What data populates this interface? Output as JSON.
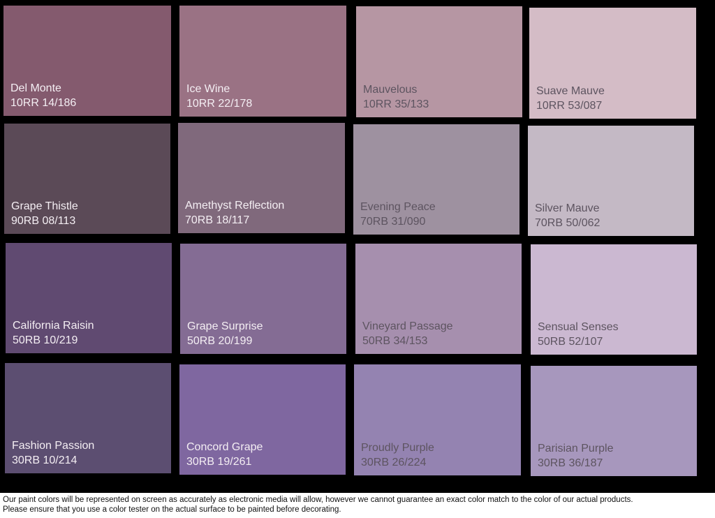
{
  "swatches": [
    {
      "name": "Del Monte",
      "code": "10RR 14/186",
      "color": "#845a6e",
      "text": "light"
    },
    {
      "name": "Ice Wine",
      "code": "10RR 22/178",
      "color": "#9a7284",
      "text": "light"
    },
    {
      "name": "Mauvelous",
      "code": "10RR 35/133",
      "color": "#b696a3",
      "text": "dark"
    },
    {
      "name": "Suave Mauve",
      "code": "10RR 53/087",
      "color": "#d4bcc6",
      "text": "dark"
    },
    {
      "name": "Grape Thistle",
      "code": "90RB 08/113",
      "color": "#5b4a57",
      "text": "light"
    },
    {
      "name": "Amethyst Reflection",
      "code": "70RB 18/117",
      "color": "#80697c",
      "text": "light"
    },
    {
      "name": "Evening Peace",
      "code": "70RB 31/090",
      "color": "#9e91a0",
      "text": "dark"
    },
    {
      "name": "Silver Mauve",
      "code": "70RB 50/062",
      "color": "#c4b9c5",
      "text": "dark"
    },
    {
      "name": "California Raisin",
      "code": "50RB 10/219",
      "color": "#604a71",
      "text": "light"
    },
    {
      "name": "Grape Surprise",
      "code": "50RB 20/199",
      "color": "#846c94",
      "text": "light"
    },
    {
      "name": "Vineyard Passage",
      "code": "50RB 34/153",
      "color": "#a68fae",
      "text": "dark"
    },
    {
      "name": "Sensual Senses",
      "code": "50RB 52/107",
      "color": "#cbb8d1",
      "text": "dark"
    },
    {
      "name": "Fashion Passion",
      "code": "30RB 10/214",
      "color": "#5c4e71",
      "text": "light"
    },
    {
      "name": "Concord Grape",
      "code": "30RB 19/261",
      "color": "#7f67a0",
      "text": "light"
    },
    {
      "name": "Proudly Purple",
      "code": "30RB 26/224",
      "color": "#9483b1",
      "text": "dark"
    },
    {
      "name": "Parisian Purple",
      "code": "30RB 36/187",
      "color": "#a797bd",
      "text": "dark"
    }
  ],
  "footer": {
    "line1": "Our paint colors will be represented on screen as accurately as electronic media will allow, however we cannot guarantee an exact color match to the color of our actual products.",
    "line2": "Please ensure that you use a color tester on the actual surface to be painted before decorating."
  }
}
